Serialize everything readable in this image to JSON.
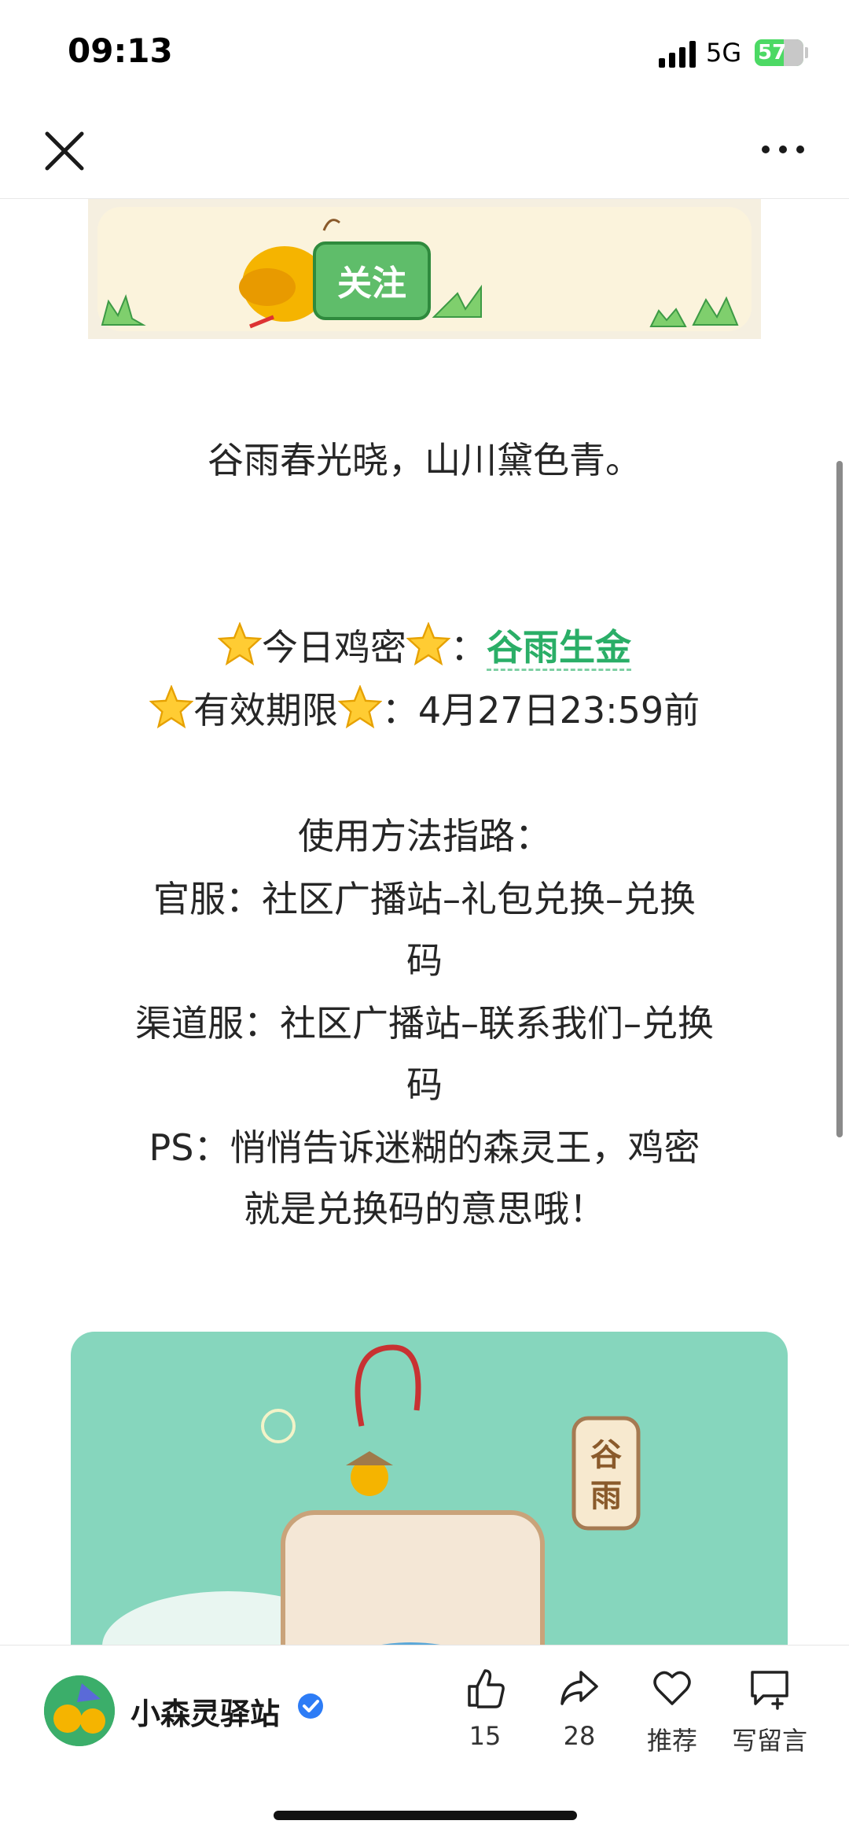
{
  "status_bar": {
    "time": "09:13",
    "network": "5G",
    "battery": "57"
  },
  "article": {
    "line1": "谷雨春光晓，山川黛色青。",
    "code_label": "今日鸡密",
    "code_sep": "：",
    "code_value": "谷雨生金",
    "expiry_label": "有效期限",
    "expiry_value": "：4月27日23:59前",
    "usage_title": "使用方法指路：",
    "official_line_1": "官服：社区广播站–礼包兑换–兑换",
    "official_line_2": "码",
    "channel_line_1": "渠道服：社区广播站–联系我们–兑换",
    "channel_line_2": "码",
    "ps_line_1": "PS：悄悄告诉迷糊的森灵王，鸡密",
    "ps_line_2": "就是兑换码的意思哦！"
  },
  "banner": {
    "follow_label": "关注"
  },
  "illustration": {
    "stamp_text": "谷雨"
  },
  "footer": {
    "account_name": "小森灵驿站",
    "like_count": "15",
    "share_count": "28",
    "recommend_label": "推荐",
    "comment_label": "写留言"
  },
  "colors": {
    "accent_green": "#2aae67",
    "illus_bg": "#86d6bd",
    "verified_blue": "#2d7cf6"
  }
}
